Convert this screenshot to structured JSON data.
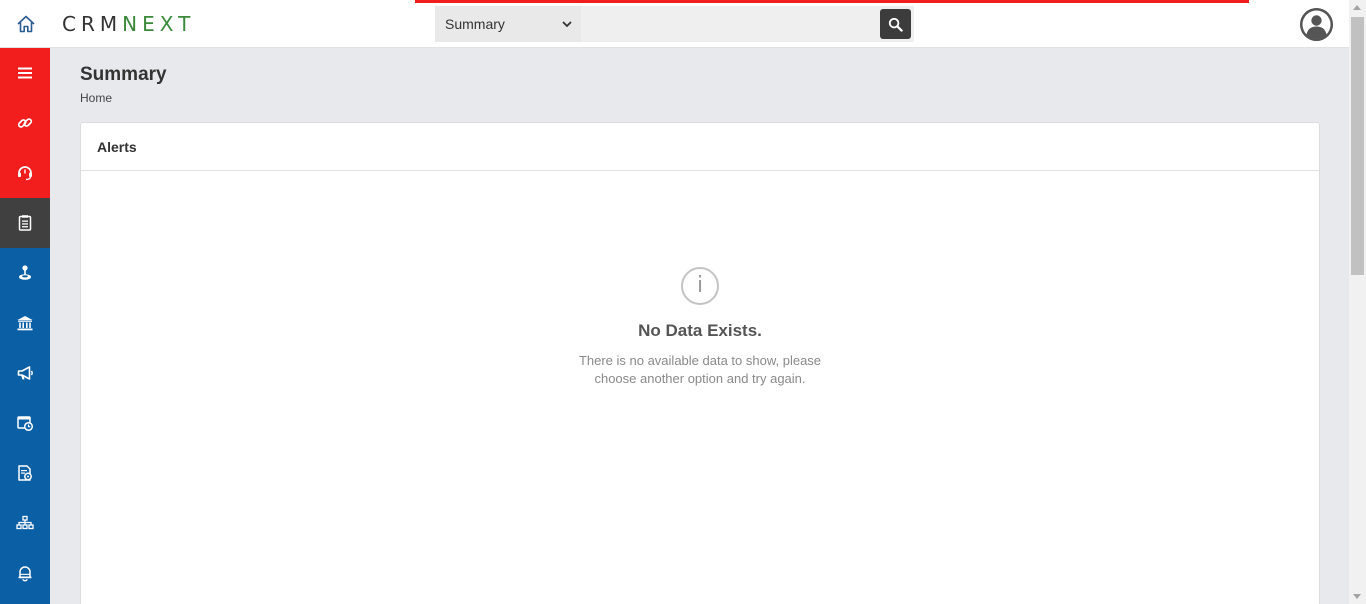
{
  "header": {
    "logo_crm": "CRM",
    "logo_next": "NEXT",
    "search": {
      "module_selected": "Summary",
      "placeholder": ""
    }
  },
  "sidebar": {
    "items": [
      {
        "icon": "menu-icon",
        "color": "#f21d1d"
      },
      {
        "icon": "link-icon",
        "color": "#f21d1d"
      },
      {
        "icon": "support-agent-icon",
        "color": "#f21d1d"
      },
      {
        "icon": "notepad-icon",
        "color": "#404040"
      },
      {
        "icon": "joystick-icon",
        "color": "#0b5fa5"
      },
      {
        "icon": "bank-icon",
        "color": "#0b5fa5"
      },
      {
        "icon": "megaphone-icon",
        "color": "#0b5fa5"
      },
      {
        "icon": "calendar-check-icon",
        "color": "#0b5fa5"
      },
      {
        "icon": "document-settings-icon",
        "color": "#0b5fa5"
      },
      {
        "icon": "org-chart-icon",
        "color": "#0b5fa5"
      },
      {
        "icon": "bell-icon",
        "color": "#0b5fa5"
      }
    ]
  },
  "page": {
    "title": "Summary",
    "breadcrumb": "Home"
  },
  "alerts_card": {
    "title": "Alerts",
    "empty_title": "No Data Exists.",
    "empty_message": "There is no available data to show, please choose another option and try again."
  },
  "colors": {
    "accent_red": "#f21d1d",
    "sidebar_blue": "#0b5fa5",
    "logo_green": "#3a8a3a"
  }
}
